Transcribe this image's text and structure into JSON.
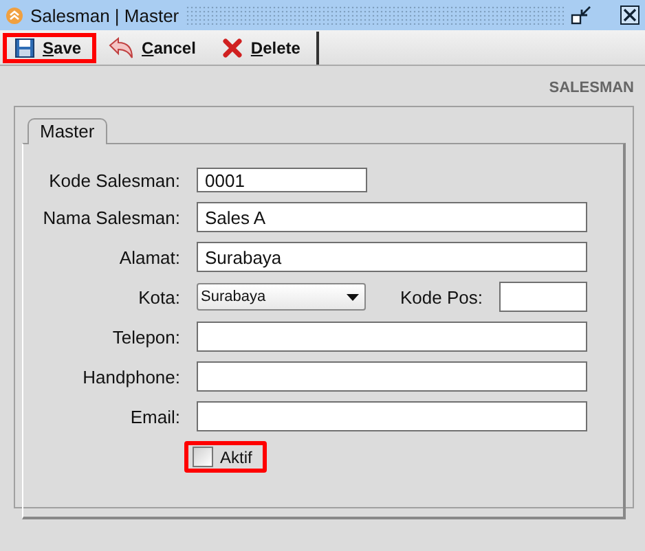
{
  "window": {
    "title": "Salesman | Master"
  },
  "toolbar": [
    {
      "label": "Save",
      "kind": "save",
      "highlighted": true
    },
    {
      "label": "Cancel",
      "kind": "cancel",
      "highlighted": false
    },
    {
      "label": "Delete",
      "kind": "delete",
      "highlighted": false
    }
  ],
  "heading": "SALESMAN",
  "tabs": [
    {
      "label": "Master",
      "selected": true
    }
  ],
  "fields": [
    {
      "label": "Kode Salesman:",
      "kind": "short",
      "value": "0001"
    },
    {
      "label": "Nama Salesman:",
      "kind": "text",
      "value": "Sales A"
    },
    {
      "label": "Alamat:",
      "kind": "text",
      "value": "Surabaya"
    },
    {
      "label": "Kota:",
      "kind": "select",
      "value": "Surabaya",
      "side_label": "Kode Pos:"
    },
    {
      "label": "Telepon:",
      "kind": "text"
    },
    {
      "label": "Handphone:",
      "kind": "text"
    },
    {
      "label": "Email:",
      "kind": "text"
    }
  ],
  "checkbox": {
    "label": "Aktif",
    "checked": false,
    "highlighted": true
  }
}
